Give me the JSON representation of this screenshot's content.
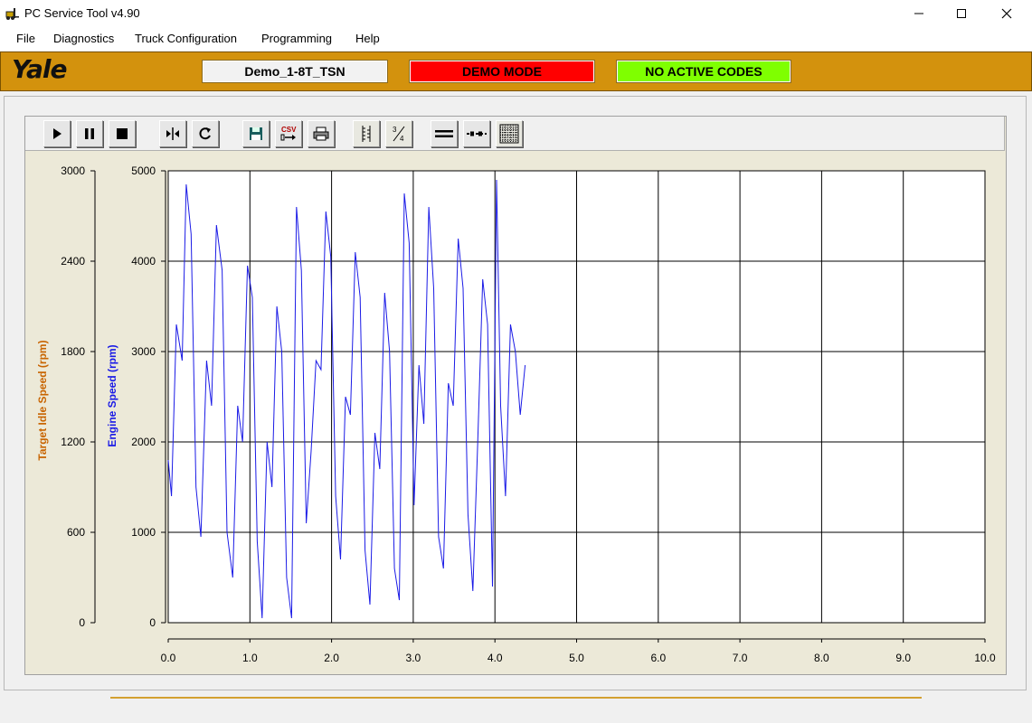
{
  "window": {
    "title": "PC Service Tool v4.90",
    "controls": [
      "minimize",
      "maximize",
      "close"
    ]
  },
  "menu": [
    "File",
    "Diagnostics",
    "Truck Configuration",
    "Programming",
    "Help"
  ],
  "banner": {
    "logo": "Yale",
    "truck_name": "Demo_1-8T_TSN",
    "mode": "DEMO MODE",
    "codes": "NO ACTIVE CODES",
    "colors": {
      "background": "#d3920d",
      "mode": "#ff0000",
      "codes": "#7fff00"
    }
  },
  "toolbar": [
    {
      "name": "play-icon"
    },
    {
      "name": "pause-icon"
    },
    {
      "name": "stop-icon"
    },
    {
      "name": "split-icon"
    },
    {
      "name": "refresh-icon"
    },
    {
      "name": "save-icon"
    },
    {
      "name": "csv-export-icon"
    },
    {
      "name": "print-icon"
    },
    {
      "name": "vertical-scale-icon"
    },
    {
      "name": "fraction-scale-icon"
    },
    {
      "name": "solid-line-icon"
    },
    {
      "name": "dotted-line-icon"
    },
    {
      "name": "grid-icon"
    }
  ],
  "chart_data": {
    "type": "line",
    "xlabel": "",
    "xlim": [
      0,
      10
    ],
    "x_ticks": [
      "0.0",
      "1.0",
      "2.0",
      "3.0",
      "4.0",
      "5.0",
      "6.0",
      "7.0",
      "8.0",
      "9.0",
      "10.0"
    ],
    "left_axis_outer": {
      "label": "Target Idle Speed (rpm)",
      "color": "#c86400",
      "ylim": [
        0,
        3000
      ],
      "ticks": [
        "0",
        "600",
        "1200",
        "1800",
        "2400",
        "3000"
      ]
    },
    "left_axis_inner": {
      "label": "Engine Speed (rpm)",
      "color": "#1a1ae6",
      "ylim": [
        0,
        5000
      ],
      "ticks": [
        "0",
        "1000",
        "2000",
        "3000",
        "4000",
        "5000"
      ]
    },
    "grid": true,
    "series": [
      {
        "name": "Engine Speed (rpm)",
        "color": "#1a1ae6",
        "x": [
          0.0,
          0.04,
          0.1,
          0.17,
          0.22,
          0.28,
          0.34,
          0.4,
          0.47,
          0.53,
          0.59,
          0.66,
          0.72,
          0.79,
          0.85,
          0.91,
          0.97,
          1.03,
          1.09,
          1.15,
          1.21,
          1.27,
          1.33,
          1.39,
          1.45,
          1.51,
          1.57,
          1.63,
          1.69,
          1.75,
          1.81,
          1.87,
          1.93,
          1.99,
          2.05,
          2.11,
          2.17,
          2.23,
          2.29,
          2.35,
          2.41,
          2.47,
          2.53,
          2.59,
          2.65,
          2.71,
          2.77,
          2.83,
          2.89,
          2.95,
          3.01,
          3.07,
          3.13,
          3.19,
          3.25,
          3.31,
          3.37,
          3.43,
          3.49,
          3.55,
          3.61,
          3.67,
          3.73,
          3.79,
          3.85,
          3.91,
          3.97,
          4.02,
          4.07,
          4.13,
          4.19,
          4.25,
          4.31,
          4.37
        ],
        "y": [
          1800,
          1400,
          3300,
          2900,
          4850,
          4300,
          1500,
          950,
          2900,
          2400,
          4400,
          3900,
          1000,
          500,
          2400,
          2000,
          3950,
          3600,
          900,
          50,
          2000,
          1500,
          3500,
          3000,
          500,
          50,
          4600,
          3900,
          1100,
          1900,
          2900,
          2800,
          4550,
          4050,
          1400,
          700,
          2500,
          2300,
          4100,
          3600,
          800,
          200,
          2100,
          1700,
          3650,
          3000,
          600,
          250,
          4750,
          4200,
          1300,
          2850,
          2200,
          4600,
          3700,
          950,
          600,
          2650,
          2400,
          4250,
          3700,
          1200,
          350,
          2000,
          3800,
          3300,
          400,
          4900,
          2400,
          1400,
          3300,
          3000,
          2300,
          2850
        ]
      }
    ]
  }
}
